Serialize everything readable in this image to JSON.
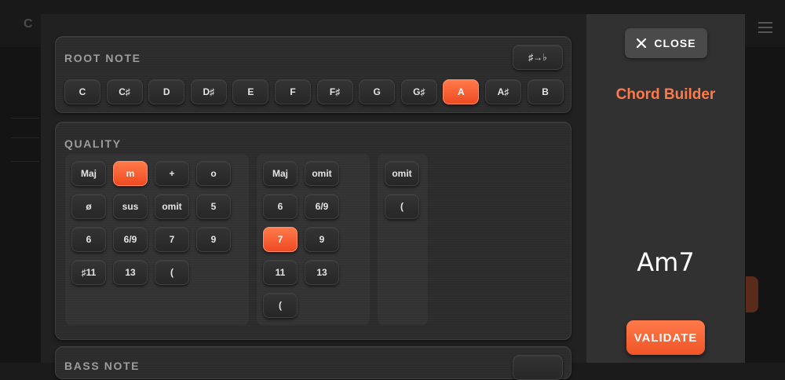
{
  "modal": {
    "close_label": "CLOSE",
    "title": "Chord Builder",
    "chord_display": "Am7",
    "validate_label": "VALIDATE"
  },
  "root_note": {
    "title": "ROOT NOTE",
    "toggle_label": "♯→♭",
    "selected": "A",
    "notes": [
      "C",
      "C♯",
      "D",
      "D♯",
      "E",
      "F",
      "F♯",
      "G",
      "G♯",
      "A",
      "A♯",
      "B"
    ]
  },
  "quality": {
    "title": "QUALITY",
    "group1": [
      "Maj",
      "m",
      "+",
      "o",
      "ø",
      "sus",
      "omit",
      "5",
      "6",
      "6/9",
      "7",
      "9",
      "♯11",
      "13",
      "("
    ],
    "group1_selected": "m",
    "group2": [
      "Maj",
      "omit",
      "6",
      "6/9",
      "7",
      "9",
      "11",
      "13",
      "("
    ],
    "group2_selected": "7",
    "group3": [
      "omit",
      "("
    ]
  },
  "bass_note": {
    "title": "BASS NOTE"
  },
  "colors": {
    "accent": "#ff6a3a",
    "panel": "#2c2c2c",
    "sidebar": "#313131"
  }
}
